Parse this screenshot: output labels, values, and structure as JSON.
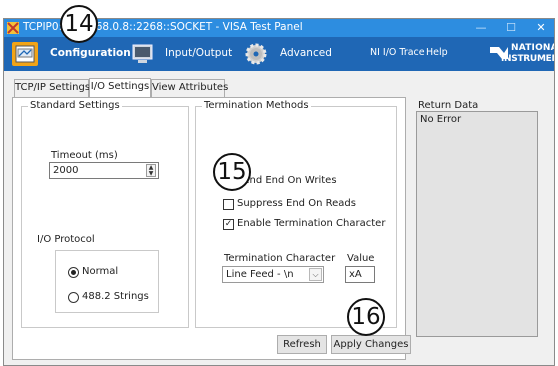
{
  "window": {
    "title": "TCPIP0::192.168.0.8::2268::SOCKET - VISA Test Panel",
    "minimize_glyph": "—",
    "maximize_glyph": "☐",
    "close_glyph": "✕"
  },
  "toolbar": {
    "configuration_label": "Configuration",
    "io_label": "Input/Output",
    "advanced_label": "Advanced",
    "trace_label": "NI I/O Trace",
    "help_label": "Help",
    "logo_line1": "NATIONAL",
    "logo_line2": "INSTRUMENTS",
    "accent_color": "#1f67b5",
    "selected_color": "#f2a417"
  },
  "tabs": [
    {
      "label": "TCP/IP Settings"
    },
    {
      "label": "I/O Settings"
    },
    {
      "label": "View Attributes"
    }
  ],
  "standard_settings": {
    "title": "Standard Settings",
    "timeout_label": "Timeout (ms)",
    "timeout_value": "2000",
    "io_protocol_label": "I/O Protocol",
    "radio_normal": "Normal",
    "radio_4882": "488.2 Strings"
  },
  "termination": {
    "title": "Termination Methods",
    "send_end_label": "Send End On Writes",
    "suppress_end_label": "Suppress End On Reads",
    "enable_char_label": "Enable Termination Character",
    "char_label": "Termination Character",
    "char_value": "Line Feed - \\n",
    "value_label": "Value",
    "value_value": "xA"
  },
  "buttons": {
    "refresh": "Refresh",
    "apply": "Apply Changes"
  },
  "return_data": {
    "label": "Return Data",
    "text": "No Error"
  },
  "callouts": {
    "c14": "14",
    "c15": "15",
    "c16": "16"
  }
}
